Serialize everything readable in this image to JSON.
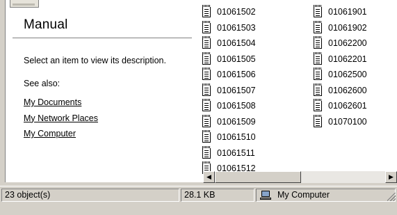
{
  "task_pane": {
    "title": "Manual",
    "description": "Select an item to view its description.",
    "see_also_label": "See also:",
    "links": [
      "My Documents",
      "My Network Places",
      "My Computer"
    ]
  },
  "files": {
    "column1": [
      "01061502",
      "01061503",
      "01061504",
      "01061505",
      "01061506",
      "01061507",
      "01061508",
      "01061509",
      "01061510",
      "01061511",
      "01061512"
    ],
    "column2": [
      "01061901",
      "01061902",
      "01062200",
      "01062201",
      "01062500",
      "01062600",
      "01062601",
      "01070100"
    ]
  },
  "scrollbar": {
    "left_arrow": "◀",
    "right_arrow": "▶"
  },
  "status_bar": {
    "objects": "23 object(s)",
    "size": "28.1 KB",
    "zone": "My Computer"
  }
}
